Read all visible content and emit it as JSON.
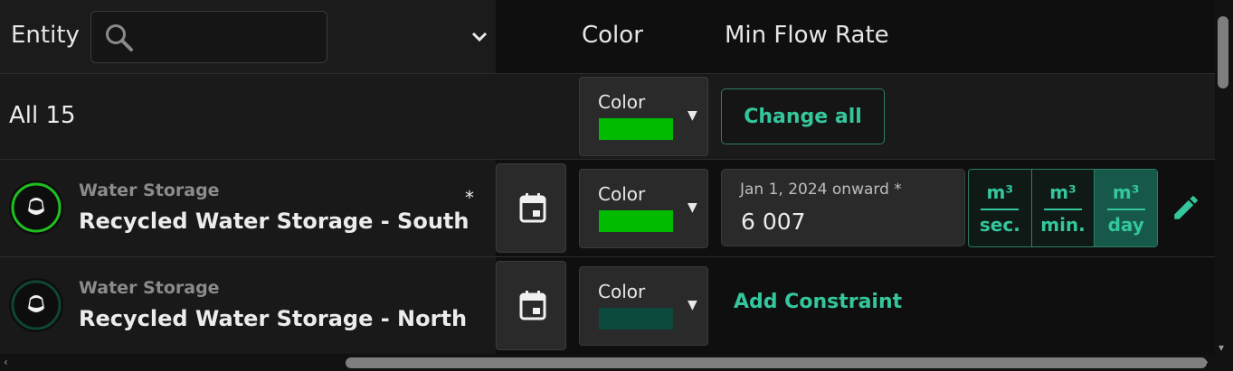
{
  "header": {
    "entity_label": "Entity",
    "search_placeholder": "",
    "color_label": "Color",
    "min_flow_label": "Min Flow Rate"
  },
  "all_row": {
    "label": "All 15",
    "color_label": "Color",
    "swatch_color": "#00bb00",
    "change_all_label": "Change all"
  },
  "rows": [
    {
      "type": "Water Storage",
      "name": "Recycled Water Storage - South",
      "asterisk": "*",
      "color_label": "Color",
      "swatch_color": "#00bb00",
      "icon_ring_color": "#1fbf1f",
      "constraint": {
        "date_label": "Jan 1, 2024 onward *",
        "value": "6 007"
      },
      "units": [
        {
          "top": "m³",
          "bottom": "sec."
        },
        {
          "top": "m³",
          "bottom": "min."
        },
        {
          "top": "m³",
          "bottom": "day"
        }
      ]
    },
    {
      "type": "Water Storage",
      "name": "Recycled Water Storage - North",
      "color_label": "Color",
      "swatch_color": "#0b4a3c",
      "icon_ring_color": "#0f4535",
      "add_constraint_label": "Add Constraint"
    }
  ],
  "icons": {
    "search": "search-icon",
    "dropdown": "chevron-down-icon",
    "calendar": "calendar-icon",
    "edit": "pencil-icon",
    "storage": "water-storage-icon"
  },
  "colors": {
    "accent": "#34c69c",
    "active_unit_bg": "#16594a"
  }
}
